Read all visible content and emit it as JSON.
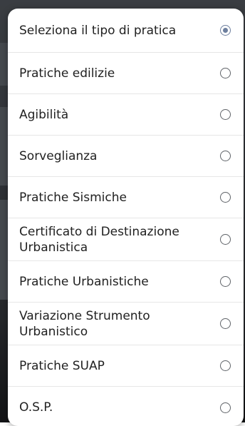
{
  "dialog": {
    "options": [
      {
        "label": "Seleziona il tipo di pratica",
        "selected": true
      },
      {
        "label": "Pratiche edilizie",
        "selected": false
      },
      {
        "label": "Agibilità",
        "selected": false
      },
      {
        "label": "Sorveglianza",
        "selected": false
      },
      {
        "label": "Pratiche Sismiche",
        "selected": false
      },
      {
        "label": "Certificato di Destinazione Urbanistica",
        "selected": false
      },
      {
        "label": "Pratiche Urbanistiche",
        "selected": false
      },
      {
        "label": "Variazione Strumento Urbanistico",
        "selected": false
      },
      {
        "label": "Pratiche SUAP",
        "selected": false
      },
      {
        "label": "O.S.P.",
        "selected": false
      }
    ]
  },
  "colors": {
    "radio_selected": "#6d7f9e",
    "radio_unselected": "#5f6368",
    "dialog_background": "#ffffff"
  }
}
